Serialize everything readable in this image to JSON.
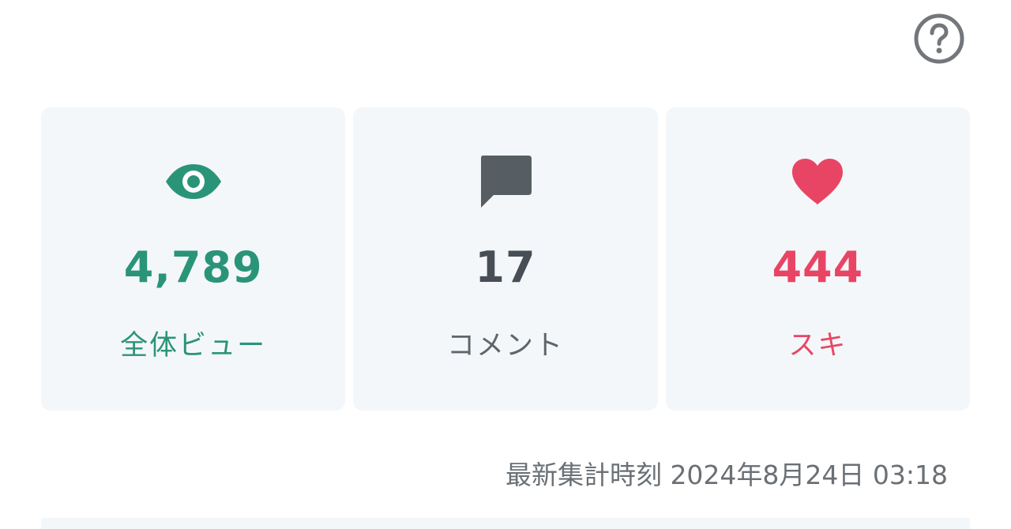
{
  "help": {
    "icon": "question-circle-icon"
  },
  "stats": {
    "views": {
      "icon": "eye-icon",
      "value": "4,789",
      "label": "全体ビュー",
      "color": "#2a9479"
    },
    "comments": {
      "icon": "speech-bubble-icon",
      "value": "17",
      "label": "コメント",
      "color": "#474e55"
    },
    "likes": {
      "icon": "heart-icon",
      "value": "444",
      "label": "スキ",
      "color": "#e84565"
    }
  },
  "footer": {
    "updated_label": "最新集計時刻",
    "updated_time": "2024年8月24日 03:18"
  }
}
